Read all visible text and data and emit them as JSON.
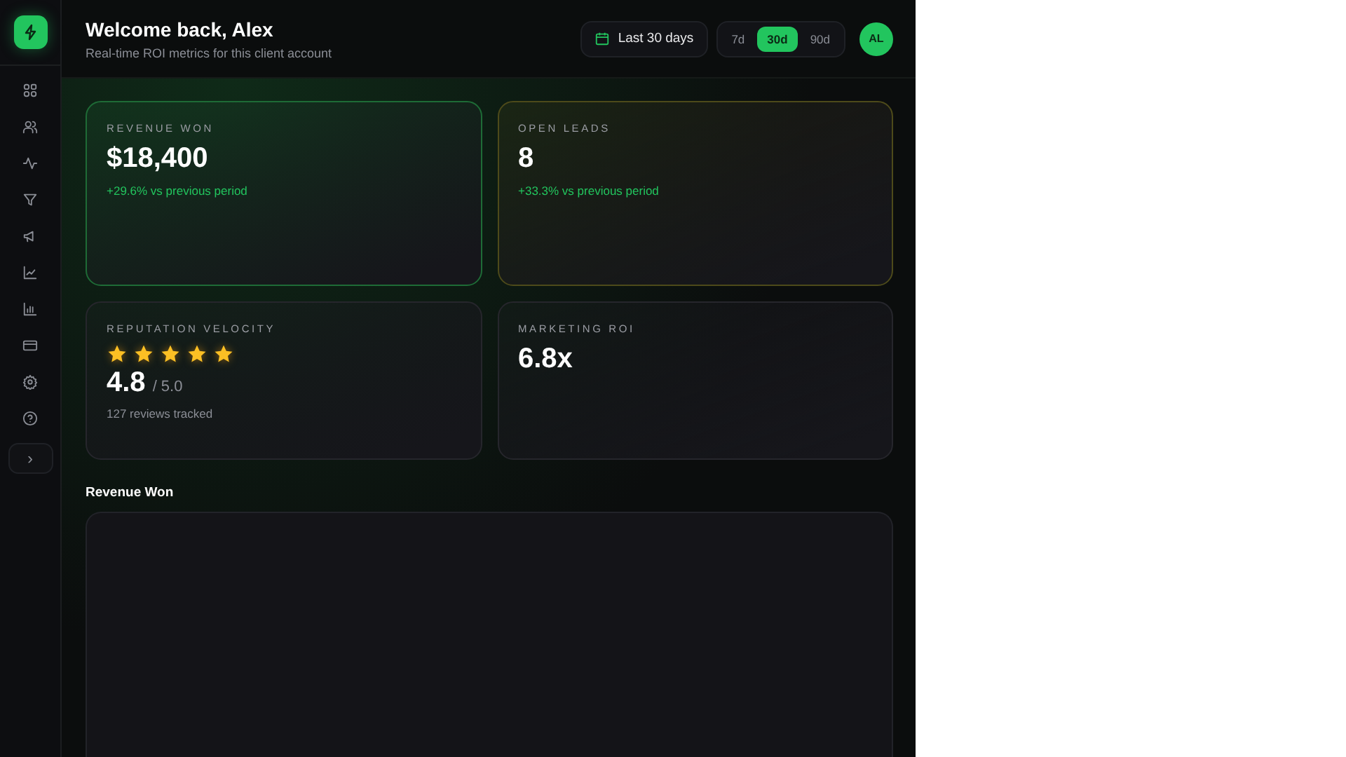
{
  "sidebar": {
    "collapse": "›"
  },
  "header": {
    "title": "Welcome back, Alex",
    "subtitle": "Real-time ROI metrics for this client account",
    "date_range": "Last 30 days",
    "periods": [
      {
        "label": "7d",
        "selected": false
      },
      {
        "label": "30d",
        "selected": true
      },
      {
        "label": "90d",
        "selected": false
      }
    ],
    "avatar": "AL"
  },
  "metrics": [
    {
      "kind": "stat",
      "label": "REVENUE WON",
      "value": "$18,400",
      "delta": "+29.6% vs previous period",
      "color": "#1e6b36"
    },
    {
      "kind": "stat",
      "label": "OPEN LEADS",
      "value": "8",
      "delta": "+33.3% vs previous period",
      "color": "#4d4a1a"
    },
    {
      "kind": "rating",
      "label": "REPUTATION VELOCITY",
      "stars": 5,
      "value": "4.8",
      "scale": "/ 5.0",
      "note": "127 reviews tracked",
      "color": "#26262c"
    },
    {
      "kind": "stat",
      "label": "MARKETING ROI",
      "value": "6.8x",
      "color": "#26262c"
    }
  ],
  "section": {
    "title": "Revenue Won"
  }
}
